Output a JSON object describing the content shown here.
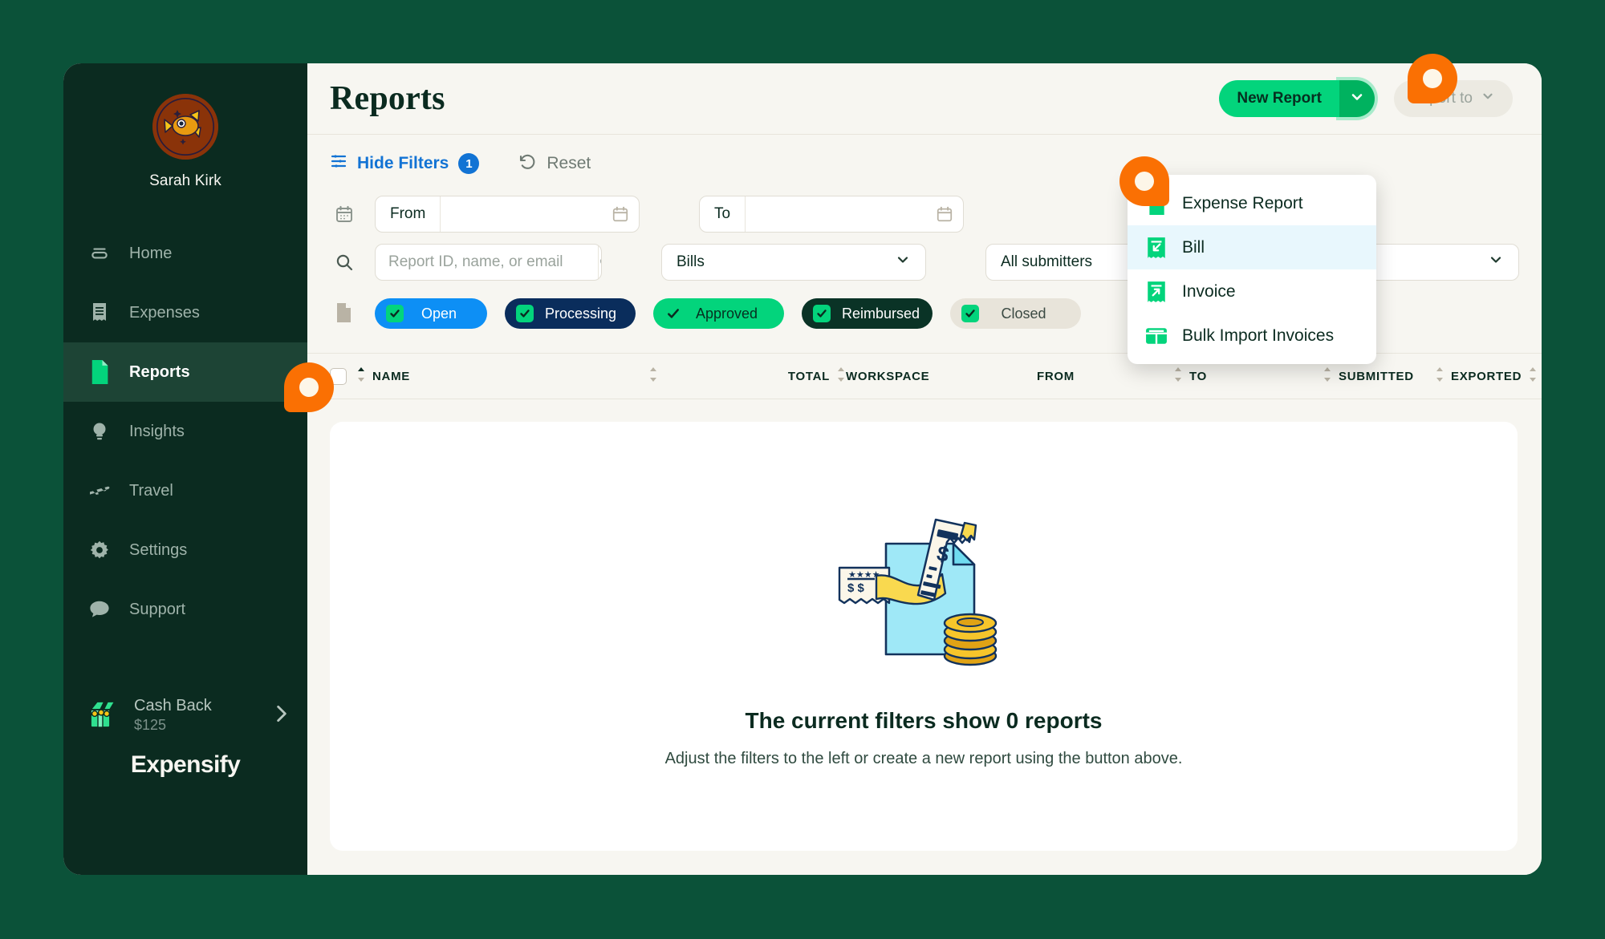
{
  "sidebar": {
    "profile_name": "Sarah Kirk",
    "avatar_icon": "goldfish-avatar",
    "items": [
      {
        "label": "Home",
        "icon": "home-icon",
        "active": false
      },
      {
        "label": "Expenses",
        "icon": "receipt-icon",
        "active": false
      },
      {
        "label": "Reports",
        "icon": "document-icon",
        "active": true
      },
      {
        "label": "Insights",
        "icon": "lightbulb-icon",
        "active": false
      },
      {
        "label": "Travel",
        "icon": "airplane-icon",
        "active": false
      },
      {
        "label": "Settings",
        "icon": "gear-icon",
        "active": false
      },
      {
        "label": "Support",
        "icon": "chat-bubble-icon",
        "active": false
      }
    ],
    "cashback": {
      "label": "Cash Back",
      "amount": "$125",
      "icon": "treasure-chest-icon",
      "chevron": "chevron-right-icon"
    },
    "brand": "Expensify"
  },
  "header": {
    "title": "Reports",
    "new_report_label": "New Report",
    "new_report_caret": "chevron-down-icon",
    "export_label": "Export to",
    "export_caret": "chevron-down-icon"
  },
  "dropdown": {
    "items": [
      {
        "label": "Expense Report",
        "icon": "document-icon",
        "highlighted": false
      },
      {
        "label": "Bill",
        "icon": "bill-receipt-icon",
        "highlighted": true
      },
      {
        "label": "Invoice",
        "icon": "invoice-receipt-icon",
        "highlighted": false
      },
      {
        "label": "Bulk Import Invoices",
        "icon": "table-grid-icon",
        "highlighted": false
      }
    ]
  },
  "filters": {
    "hide_filters_label": "Hide Filters",
    "hide_filters_icon": "filter-list-icon",
    "active_filter_count": "1",
    "reset_label": "Reset",
    "reset_icon": "undo-icon",
    "date_row_icon": "calendar-icon",
    "from_label": "From",
    "from_value": "",
    "from_calendar_icon": "calendar-small-icon",
    "to_label": "To",
    "to_value": "",
    "to_calendar_icon": "calendar-small-icon",
    "search_row_icon": "search-icon",
    "search_placeholder": "Report ID, name, or email",
    "search_value": "",
    "search_button_icon": "search-icon",
    "type_select_value": "Bills",
    "type_select_caret": "chevron-down-icon",
    "submitters_select_value": "All submitters",
    "submitters_select_caret": "chevron-down-icon",
    "status_row_icon": "document-outline-icon",
    "status_chips": [
      {
        "label": "Open",
        "checked": true,
        "checkbox_style": "box"
      },
      {
        "label": "Processing",
        "checked": true,
        "checkbox_style": "box"
      },
      {
        "label": "Approved",
        "checked": true,
        "checkbox_style": "bare"
      },
      {
        "label": "Reimbursed",
        "checked": true,
        "checkbox_style": "box"
      },
      {
        "label": "Closed",
        "checked": true,
        "checkbox_style": "box"
      }
    ]
  },
  "table": {
    "columns": [
      {
        "label": "NAME",
        "sortable": true
      },
      {
        "label": "",
        "sortable": true
      },
      {
        "label": "TOTAL",
        "sortable": true
      },
      {
        "label": "WORKSPACE",
        "sortable": false
      },
      {
        "label": "FROM",
        "sortable": true
      },
      {
        "label": "TO",
        "sortable": true
      },
      {
        "label": "SUBMITTED",
        "sortable": true
      },
      {
        "label": "EXPORTED",
        "sortable": true
      }
    ],
    "rows": []
  },
  "empty_state": {
    "illustration": "document-receipts-coins-illustration",
    "title": "The current filters show 0 reports",
    "subtitle": "Adjust the filters to the left or create a new report using the button above."
  },
  "markers": [
    {
      "name": "marker-reports-nav",
      "shape": "point-bottom-left"
    },
    {
      "name": "marker-bill-menu-item",
      "shape": "point-bottom-right"
    },
    {
      "name": "marker-new-report-caret",
      "shape": "point-bottom-left"
    }
  ],
  "colors": {
    "brand_green": "#03d47c",
    "sidebar_dark": "#0b2b20",
    "page_bg": "#0b5239",
    "accent_blue": "#1273d4",
    "marker_orange": "#fa7003",
    "highlight_blue": "#e8f7fd"
  }
}
